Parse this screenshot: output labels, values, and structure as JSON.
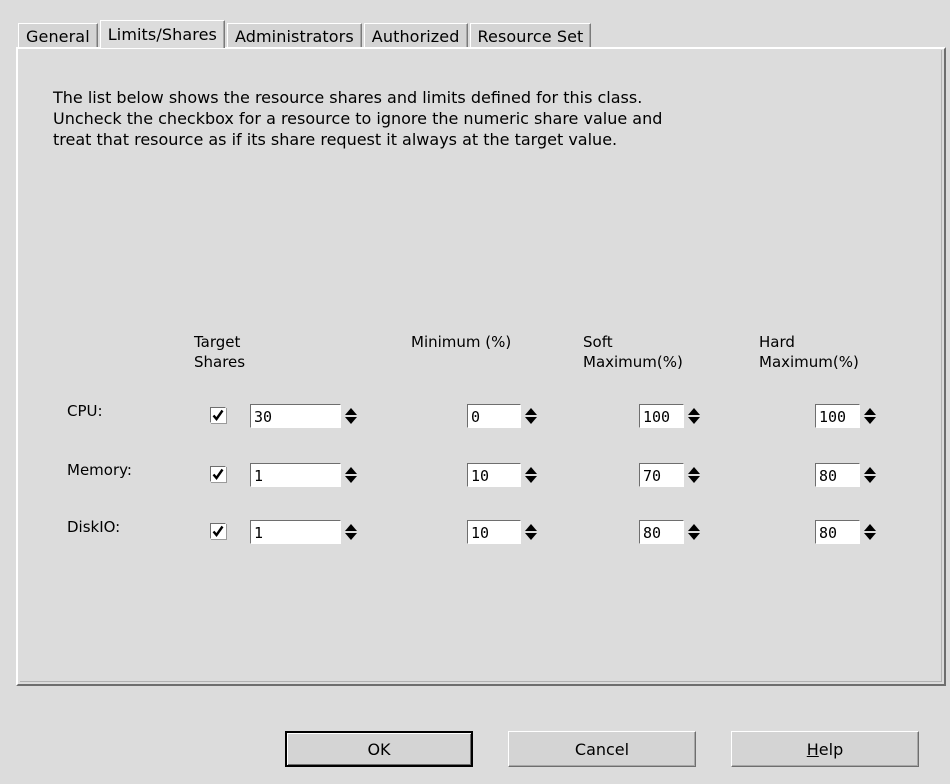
{
  "tabs": [
    {
      "label": "General",
      "active": false
    },
    {
      "label": "Limits/Shares",
      "active": true
    },
    {
      "label": "Administrators",
      "active": false
    },
    {
      "label": "Authorized",
      "active": false
    },
    {
      "label": "Resource Set",
      "active": false
    }
  ],
  "description": {
    "line1": "The list below shows the resource shares and limits defined for this class.",
    "line2": "Uncheck the checkbox for a resource to ignore the numeric share value and",
    "line3": "treat that resource as if its share request it always at the target value."
  },
  "columns": {
    "target_1": "Target",
    "target_2": "Shares",
    "minimum": "Minimum (%)",
    "soft_1": "Soft",
    "soft_2": "Maximum(%)",
    "hard_1": "Hard",
    "hard_2": "Maximum(%)"
  },
  "rows": [
    {
      "label": "CPU:",
      "checked": true,
      "target": "30",
      "minimum": "0",
      "soft": "100",
      "hard": "100"
    },
    {
      "label": "Memory:",
      "checked": true,
      "target": "1",
      "minimum": "10",
      "soft": "70",
      "hard": "80"
    },
    {
      "label": "DiskIO:",
      "checked": true,
      "target": "1",
      "minimum": "10",
      "soft": "80",
      "hard": "80"
    }
  ],
  "buttons": {
    "ok": "OK",
    "cancel": "Cancel",
    "help_mnemonic": "H",
    "help_rest": "elp"
  },
  "icons": {
    "checkbox": "checkmark-icon",
    "spinner": "spinner-arrows-icon"
  }
}
